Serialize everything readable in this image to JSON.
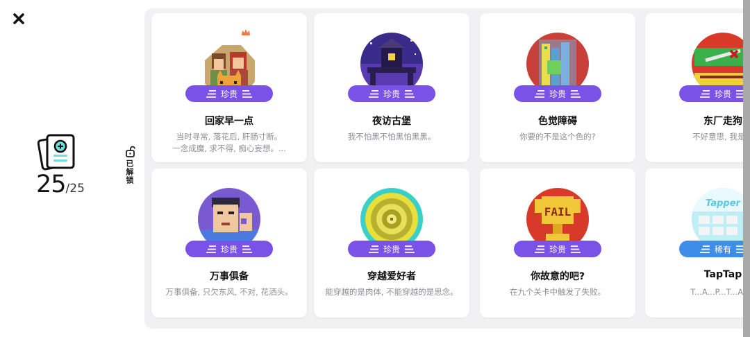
{
  "summary": {
    "unlocked": "25",
    "total": "/25"
  },
  "side_tab": {
    "label": "已解锁"
  },
  "cards": [
    {
      "title": "回家早一点",
      "desc": [
        "当时寻常, 落花后, 肝肠寸断。",
        "一念成魔, 求不得, 痴心妄想。..."
      ],
      "badge": "珍贵",
      "badge_color": "#7b52e8",
      "icon": "couple-cat-pixel-icon"
    },
    {
      "title": "夜访古堡",
      "desc": [
        "我不怕黑不怕黑怕黑黑。"
      ],
      "badge": "珍贵",
      "badge_color": "#7b52e8",
      "icon": "castle-night-pixel-icon"
    },
    {
      "title": "色觉障碍",
      "desc": [
        "你要的不是这个色的?"
      ],
      "badge": "珍贵",
      "badge_color": "#7b52e8",
      "icon": "color-blocks-pixel-icon"
    },
    {
      "title": "东厂走狗",
      "desc": [
        "不好意思, 我是反"
      ],
      "badge": "珍贵",
      "badge_color": "#7b52e8",
      "icon": "bad-guy-pixel-icon"
    },
    {
      "title": "万事俱备",
      "desc": [
        "万事俱备, 只欠东风, 不对, 花洒头。"
      ],
      "badge": "珍贵",
      "badge_color": "#7b52e8",
      "icon": "ok-hand-man-pixel-icon"
    },
    {
      "title": "穿越爱好者",
      "desc": [
        "能穿越的是肉体, 不能穿越的是思念。"
      ],
      "badge": "珍贵",
      "badge_color": "#7b52e8",
      "icon": "portal-vortex-pixel-icon"
    },
    {
      "title": "你故意的吧?",
      "desc": [
        "在九个关卡中触发了失败。"
      ],
      "badge": "珍贵",
      "badge_color": "#7b52e8",
      "icon": "fail-trophy-pixel-icon"
    },
    {
      "title": "TapTap",
      "desc": [
        "T...A...P...T...A...P"
      ],
      "badge": "稀有",
      "badge_color": "#3e8de9",
      "icon": "tapper-pixel-icon"
    }
  ]
}
